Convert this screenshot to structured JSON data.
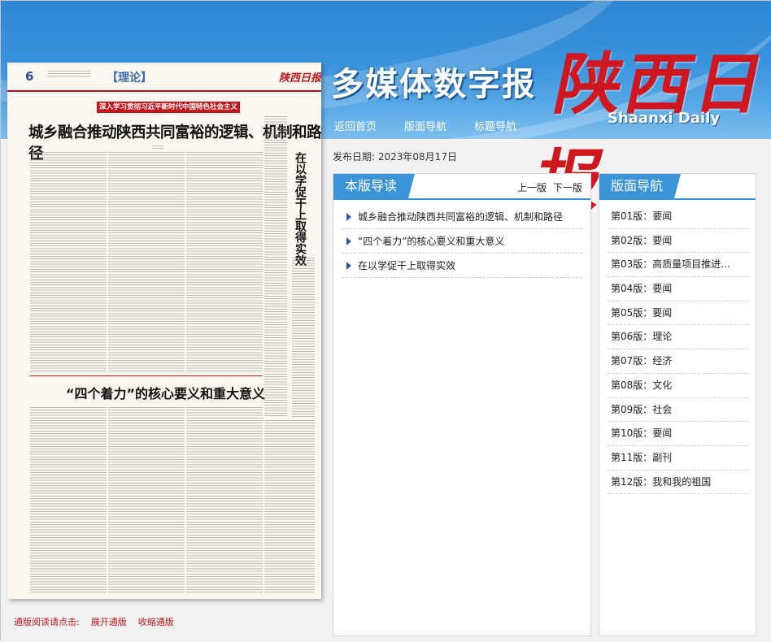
{
  "header": {
    "brand_title": "多媒体数字报",
    "logo_cn": "陕西日报",
    "logo_en": "Shaanxi Daily",
    "nav": [
      "返回首页",
      "版面导航",
      "标题导航"
    ]
  },
  "publish": {
    "label": "发布日期:",
    "date": "2023年08月17日"
  },
  "newspaper": {
    "page_number": "6",
    "section": "【理论】",
    "masthead": "陕西日报",
    "theme_banner": "深入学习贯彻习近平新时代中国特色社会主义思想",
    "headline_1": "城乡融合推动陕西共同富裕的逻辑、机制和路径",
    "headline_2": "“四个着力”的核心要义和重大意义",
    "headline_vertical": "在以学促干上取得实效"
  },
  "footer_links": {
    "label": "通版阅读请点击:",
    "expand": "展开通版",
    "collapse": "收缩通版"
  },
  "article_panel": {
    "title": "本版导读",
    "prev": "上一版",
    "next": "下一版",
    "articles": [
      "城乡融合推动陕西共同富裕的逻辑、机制和路径",
      "“四个着力”的核心要义和重大意义",
      "在以学促干上取得实效"
    ]
  },
  "page_panel": {
    "title": "版面导航",
    "pages": [
      "第01版：要闻",
      "第02版：要闻",
      "第03版：高质量项目推进...",
      "第04版：要闻",
      "第05版：要闻",
      "第06版：理论",
      "第07版：经济",
      "第08版：文化",
      "第09版：社会",
      "第10版：要闻",
      "第11版：副刊",
      "第12版：我和我的祖国"
    ]
  }
}
